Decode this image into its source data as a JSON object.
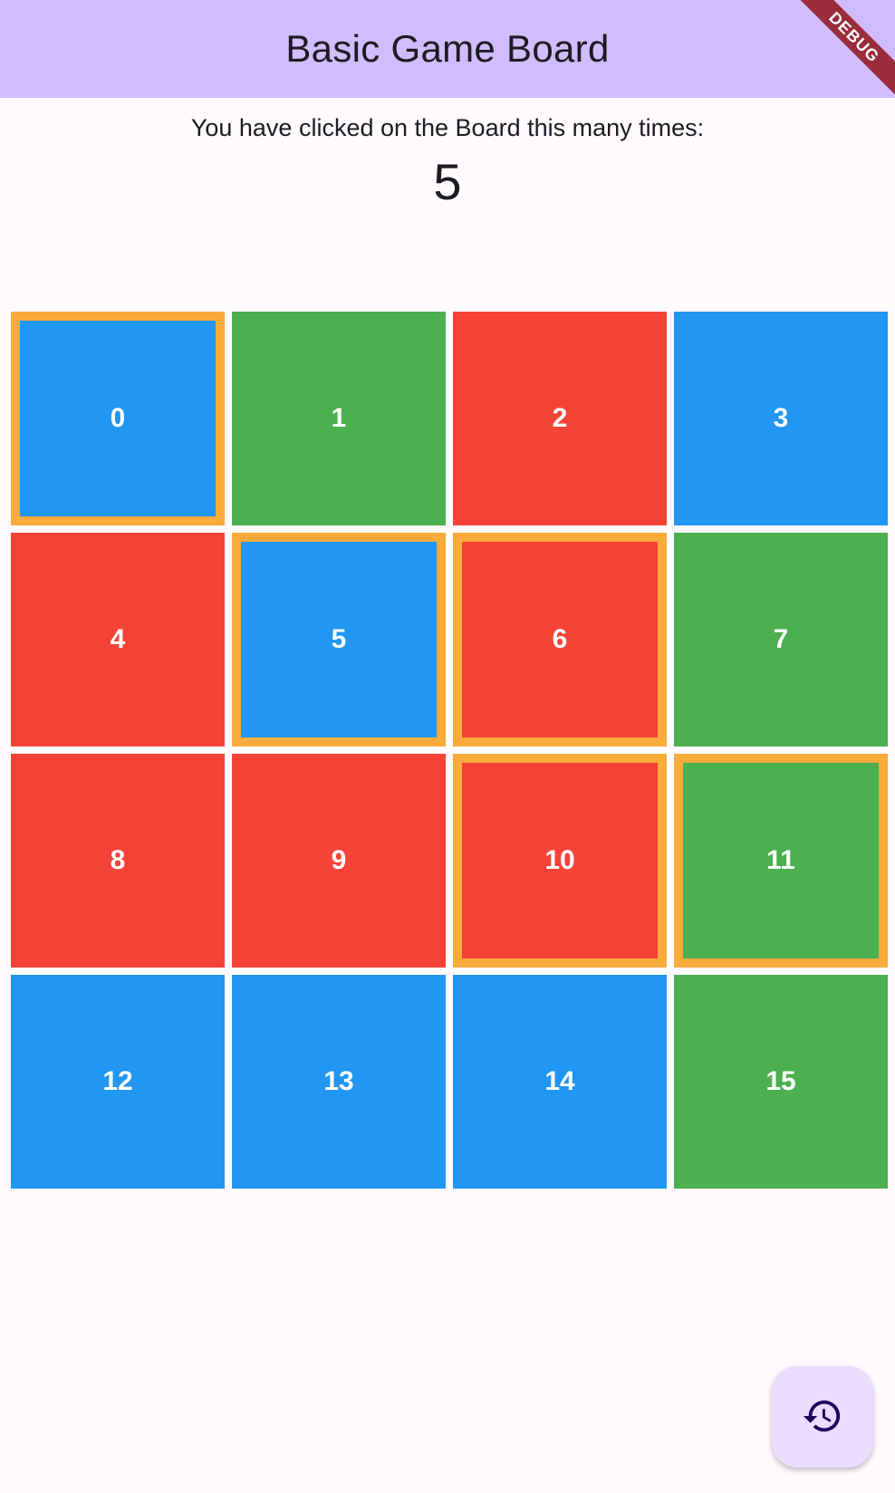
{
  "appbar": {
    "title": "Basic Game Board"
  },
  "debug_banner": {
    "label": "DEBUG"
  },
  "counter": {
    "caption": "You have clicked on the Board this many times:",
    "value": "5"
  },
  "colors": {
    "blue": "#2196f3",
    "green": "#4caf50",
    "red": "#f44336",
    "selected_border": "#f9ab3c",
    "appbar": "#d1bcff",
    "fab": "#eaddff"
  },
  "board": {
    "tiles": [
      {
        "label": "0",
        "color": "blue",
        "selected": true
      },
      {
        "label": "1",
        "color": "green",
        "selected": false
      },
      {
        "label": "2",
        "color": "red",
        "selected": false
      },
      {
        "label": "3",
        "color": "blue",
        "selected": false
      },
      {
        "label": "4",
        "color": "red",
        "selected": false
      },
      {
        "label": "5",
        "color": "blue",
        "selected": true
      },
      {
        "label": "6",
        "color": "red",
        "selected": true
      },
      {
        "label": "7",
        "color": "green",
        "selected": false
      },
      {
        "label": "8",
        "color": "red",
        "selected": false
      },
      {
        "label": "9",
        "color": "red",
        "selected": false
      },
      {
        "label": "10",
        "color": "red",
        "selected": true
      },
      {
        "label": "11",
        "color": "green",
        "selected": true
      },
      {
        "label": "12",
        "color": "blue",
        "selected": false
      },
      {
        "label": "13",
        "color": "blue",
        "selected": false
      },
      {
        "label": "14",
        "color": "blue",
        "selected": false
      },
      {
        "label": "15",
        "color": "green",
        "selected": false
      }
    ]
  },
  "fab": {
    "icon": "history-icon"
  }
}
